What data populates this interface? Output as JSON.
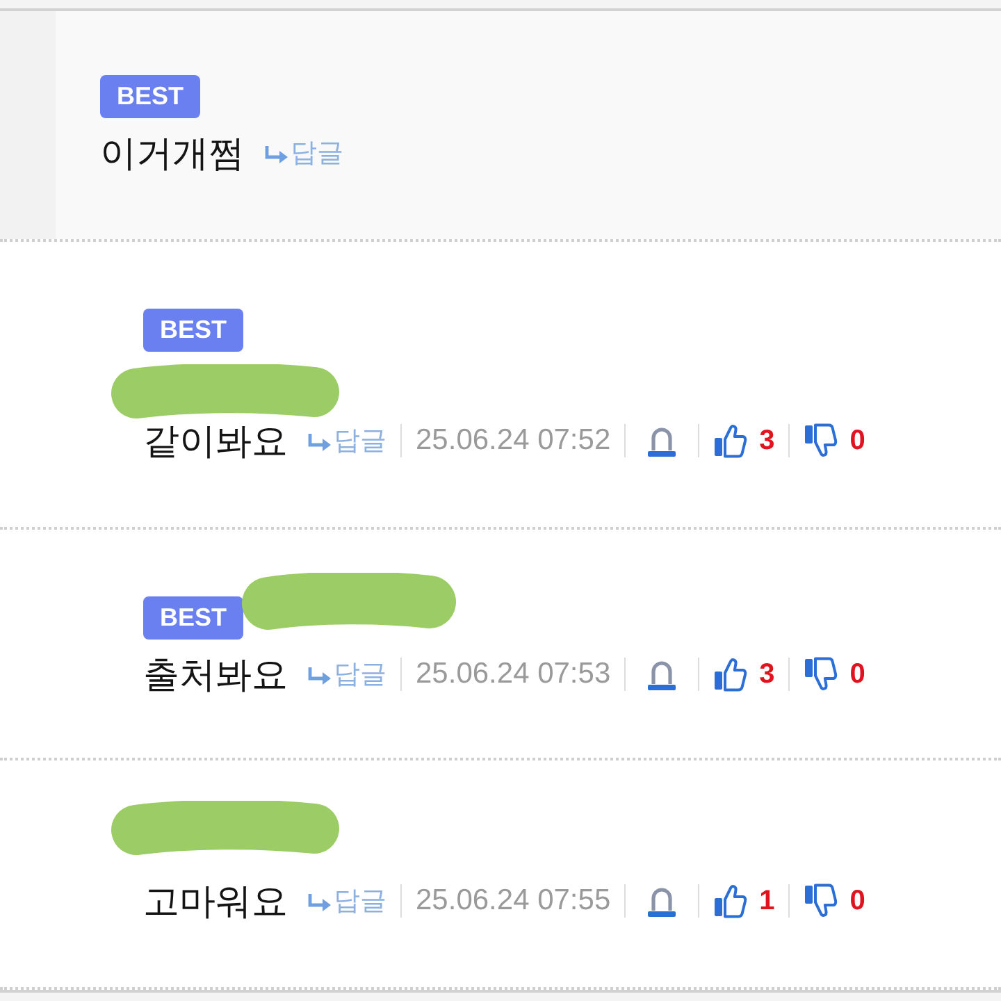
{
  "comments": [
    {
      "kind": "featured",
      "badge": "BEST",
      "text": "이거개쩜",
      "reply": "답글"
    },
    {
      "kind": "comment",
      "badge": "BEST",
      "redaction": {
        "kind": "line"
      },
      "text": "같이봐요",
      "reply": "답글",
      "date": "25.06.24 07:52",
      "likes": "3",
      "dislikes": "0"
    },
    {
      "kind": "comment",
      "badge": "BEST",
      "redaction": {
        "kind": "beside_badge"
      },
      "text": "출처봐요",
      "reply": "답글",
      "date": "25.06.24 07:53",
      "likes": "3",
      "dislikes": "0"
    },
    {
      "kind": "comment",
      "redaction": {
        "kind": "line"
      },
      "text": "고마워요",
      "reply": "답글",
      "date": "25.06.24 07:55",
      "likes": "1",
      "dislikes": "0"
    }
  ]
}
